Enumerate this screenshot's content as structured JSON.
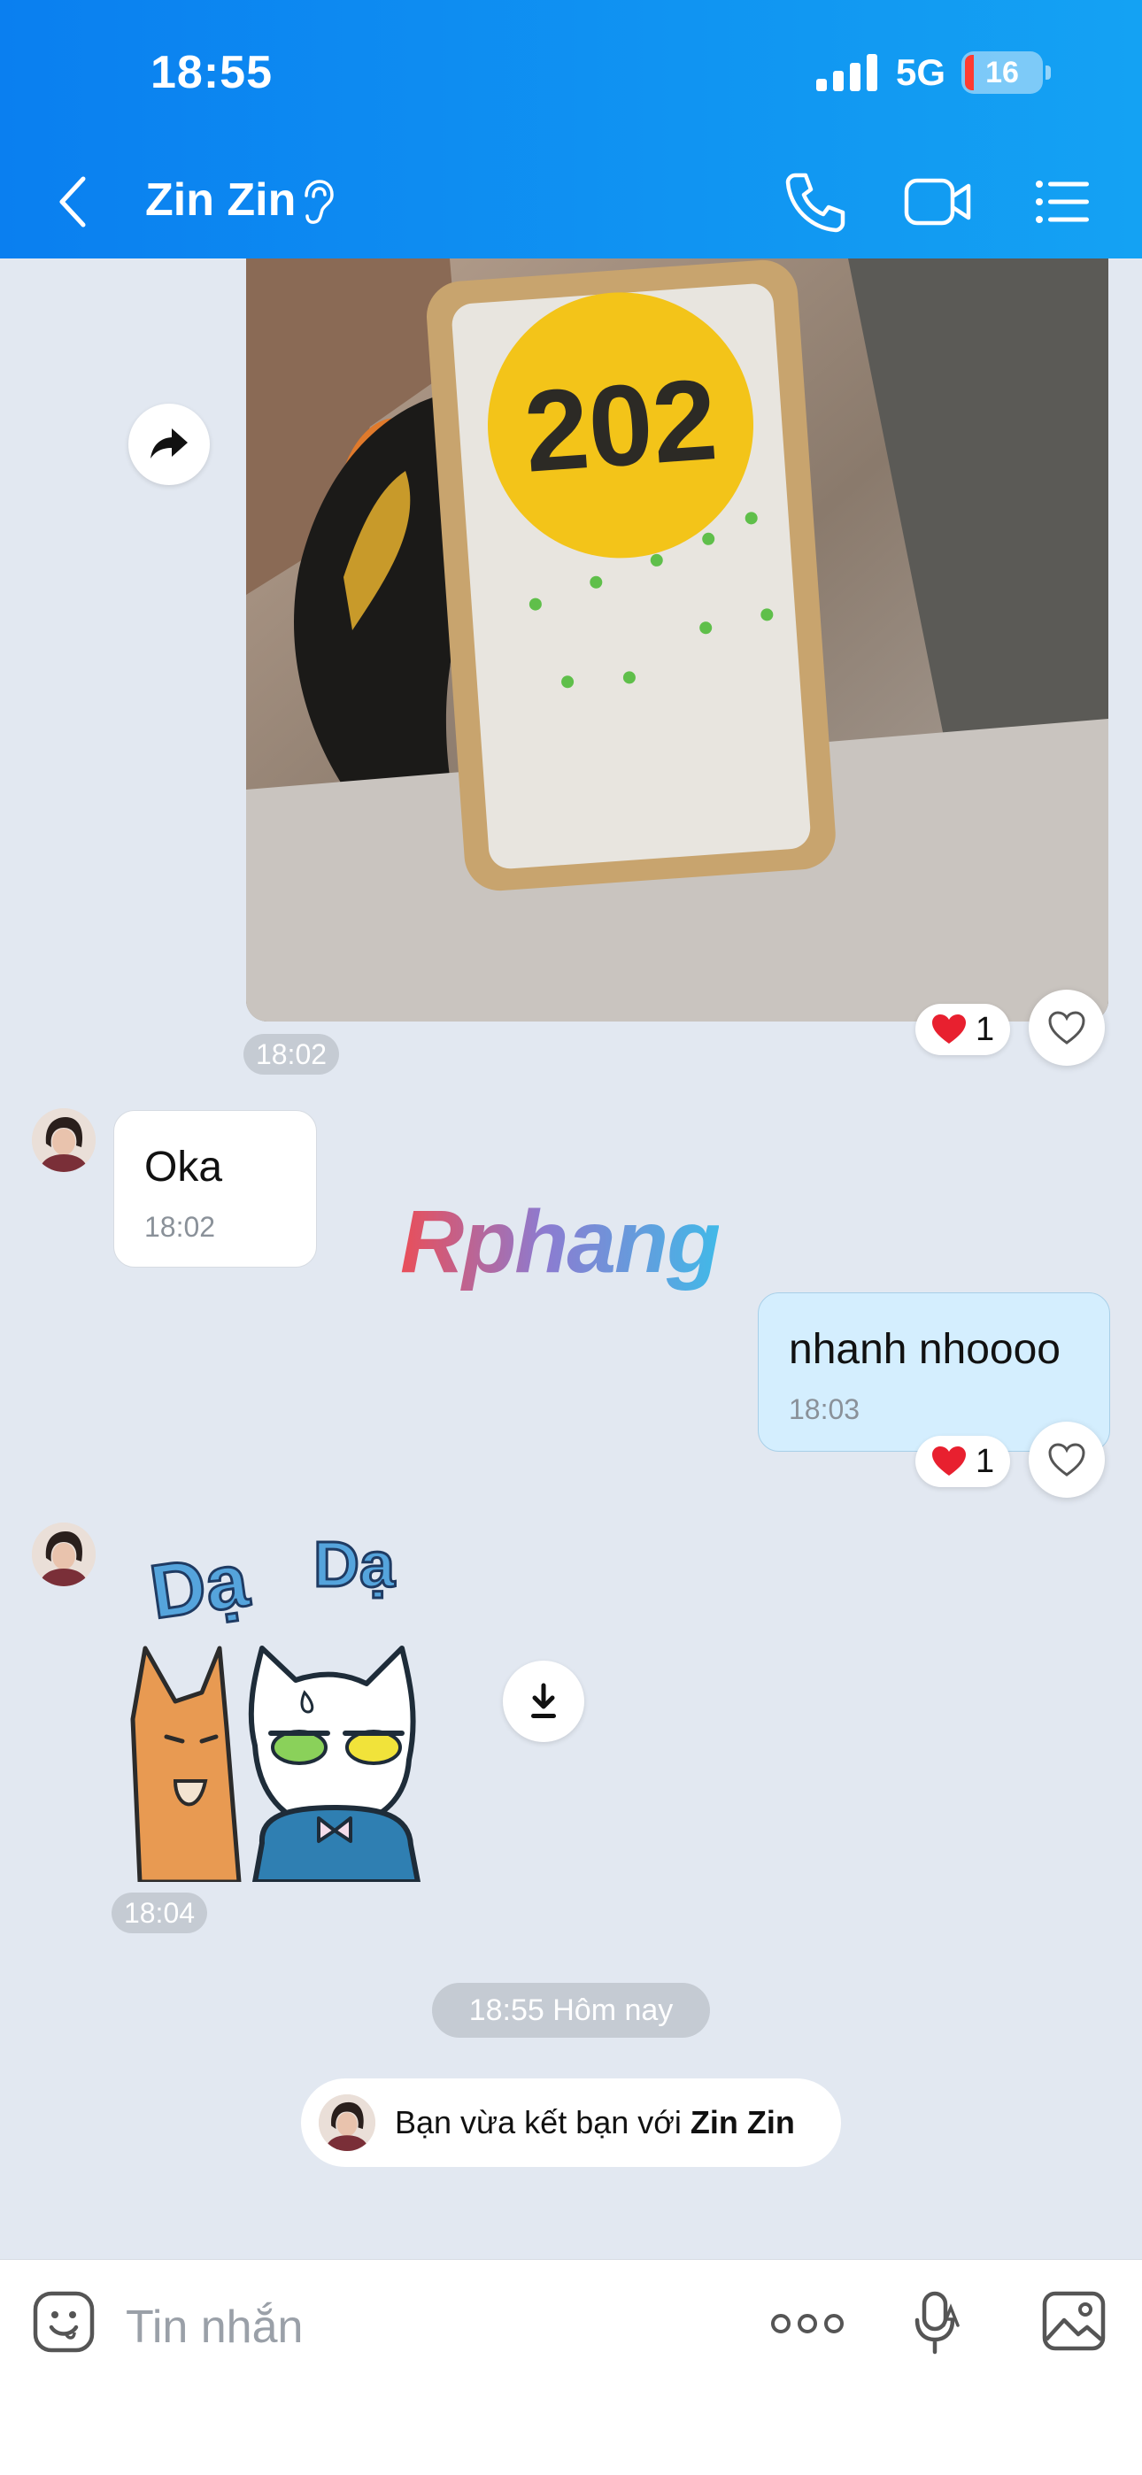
{
  "status_bar": {
    "time": "18:55",
    "network": "5G",
    "battery": "16"
  },
  "header": {
    "contact_name": "Zin Zin"
  },
  "messages": {
    "photo": {
      "plate_text": "202",
      "time": "18:02",
      "reaction_count": "1"
    },
    "oka": {
      "text": "Oka",
      "time": "18:02"
    },
    "watermark": "Rphang",
    "mine": {
      "text": "nhanh nhoooo",
      "time": "18:03",
      "reaction_count": "1"
    },
    "sticker": {
      "text_left": "Dạ",
      "text_right": "Dạ",
      "time": "18:04"
    },
    "divider": "18:55 Hôm nay",
    "friend_notice": {
      "prefix": "Bạn vừa kết bạn với ",
      "name": "Zin Zin"
    }
  },
  "input": {
    "placeholder": "Tin nhắn"
  },
  "colors": {
    "header_start": "#0a7ff0",
    "header_end": "#14a2f3",
    "background": "#e2e8f1",
    "outgoing_bubble": "#d4eefe",
    "heart": "#e8202f"
  },
  "icons": [
    "chevron-left-icon",
    "hearing-icon",
    "phone-icon",
    "video-icon",
    "list-icon",
    "share-icon",
    "heart-icon",
    "heart-outline-icon",
    "download-icon",
    "emoji-icon",
    "more-icon",
    "voice-icon",
    "image-icon"
  ]
}
